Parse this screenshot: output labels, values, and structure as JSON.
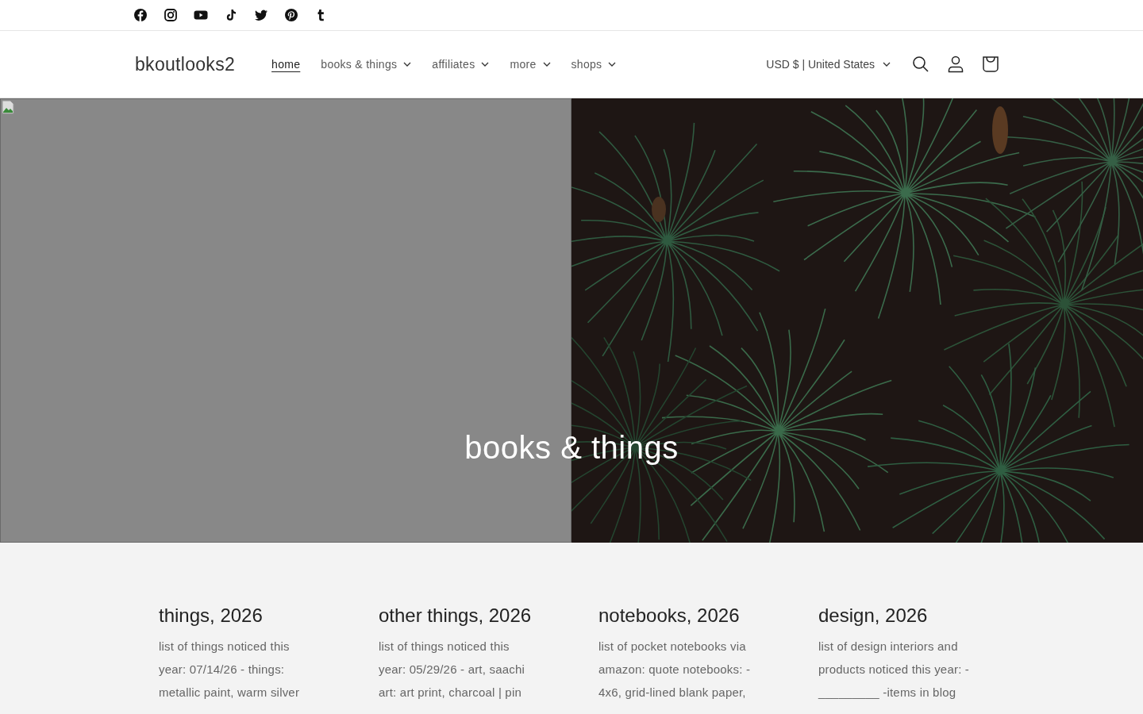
{
  "social_links": [
    {
      "kind": "facebook"
    },
    {
      "kind": "instagram"
    },
    {
      "kind": "youtube"
    },
    {
      "kind": "tiktok"
    },
    {
      "kind": "twitter"
    },
    {
      "kind": "pinterest"
    },
    {
      "kind": "tumblr"
    }
  ],
  "header": {
    "logo": "bkoutlooks2",
    "nav": [
      {
        "label": "home",
        "selected": true,
        "dropdown": false
      },
      {
        "label": "books & things",
        "selected": false,
        "dropdown": true
      },
      {
        "label": "affiliates",
        "selected": false,
        "dropdown": true
      },
      {
        "label": "more",
        "selected": false,
        "dropdown": true
      },
      {
        "label": "shops",
        "selected": false,
        "dropdown": true
      }
    ],
    "currency": "USD $ | United States"
  },
  "hero": {
    "heading": "books & things",
    "left": {
      "kind": "broken-image"
    }
  },
  "blog_posts": [
    {
      "title": "things, 2026",
      "excerpt": "list of things noticed this year: 07/14/26 - things: metallic paint, warm silver"
    },
    {
      "title": "other things, 2026",
      "excerpt": "list of things noticed this year: 05/29/26 - art, saachi art: art print, charcoal | pin"
    },
    {
      "title": "notebooks, 2026",
      "excerpt": "list of pocket notebooks via amazon: quote notebooks: - 4x6, grid-lined blank paper,"
    },
    {
      "title": "design, 2026",
      "excerpt": "list of design interiors and products noticed this year: - _________ -items in blog"
    }
  ]
}
